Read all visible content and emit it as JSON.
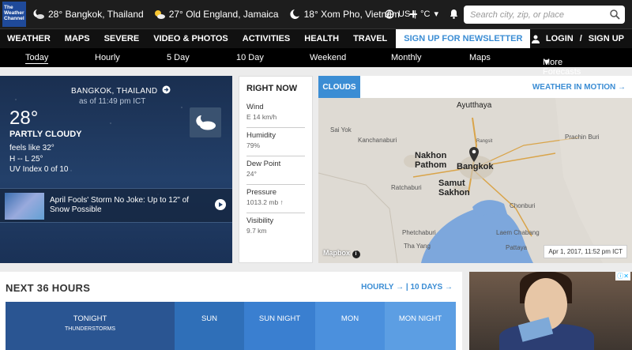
{
  "header": {
    "logo_text": "The Weather Channel",
    "locations": [
      {
        "temp": "28°",
        "name": "Bangkok, Thailand",
        "icon": "night-cloudy-icon"
      },
      {
        "temp": "27°",
        "name": "Old England, Jamaica",
        "icon": "partly-sunny-icon"
      },
      {
        "temp": "18°",
        "name": "Xom Pho, Vietnam",
        "icon": "night-clear-icon"
      }
    ],
    "units_label": "US",
    "units_temp": "°C",
    "search_placeholder": "Search city, zip, or place"
  },
  "nav": {
    "items": [
      "WEATHER",
      "MAPS",
      "SEVERE",
      "VIDEO & PHOTOS",
      "ACTIVITIES",
      "HEALTH",
      "TRAVEL"
    ],
    "newsletter": "SIGN UP FOR NEWSLETTER",
    "login": "LOGIN",
    "signup": "SIGN UP"
  },
  "subnav": {
    "items": [
      "Today",
      "Hourly",
      "5 Day",
      "10 Day",
      "Weekend",
      "Monthly",
      "Maps",
      "More Forecasts"
    ]
  },
  "current": {
    "location": "BANGKOK, THAILAND",
    "as_of": "as of 11:49 pm ICT",
    "temp": "28°",
    "phrase": "PARTLY CLOUDY",
    "feels_like": "feels like 32°",
    "hi_lo": "H -- L 25°",
    "uv": "UV Index 0 of 10",
    "story_title": "April Fools' Storm No Joke: Up to 12\" of Snow Possible"
  },
  "right_now": {
    "title": "RIGHT NOW",
    "rows": [
      {
        "label": "Wind",
        "value": "E 14 km/h"
      },
      {
        "label": "Humidity",
        "value": "79%"
      },
      {
        "label": "Dew Point",
        "value": "24°"
      },
      {
        "label": "Pressure",
        "value": "1013.2 mb ↑"
      },
      {
        "label": "Visibility",
        "value": "9.7 km"
      }
    ]
  },
  "map": {
    "tab": "CLOUDS",
    "link": "WEATHER IN MOTION →",
    "labels": [
      "Ayutthaya",
      "Sai Yok",
      "Kanchanaburi",
      "Nakhon Pathom",
      "Bangkok",
      "Samut Sakhon",
      "Ratchaburi",
      "Prachin Buri",
      "Chonburi",
      "Phetchaburi",
      "Tha Yang",
      "Pattaya",
      "Laem Chabang",
      "Rangsit"
    ],
    "timestamp": "Apr 1, 2017, 11:52 pm ICT",
    "attribution": "Mapbox"
  },
  "next36": {
    "title": "NEXT 36 HOURS",
    "hourly": "HOURLY",
    "tenday": "10 DAYS",
    "periods": [
      {
        "label": "TONIGHT",
        "sub": "THUNDERSTORMS",
        "color": "#2a5592"
      },
      {
        "label": "SUN",
        "sub": "",
        "color": "#2f6fb8"
      },
      {
        "label": "SUN NIGHT",
        "sub": "",
        "color": "#3a7fd0"
      },
      {
        "label": "MON",
        "sub": "",
        "color": "#4b90dd"
      },
      {
        "label": "MON NIGHT",
        "sub": "",
        "color": "#5c9ee3"
      }
    ]
  }
}
